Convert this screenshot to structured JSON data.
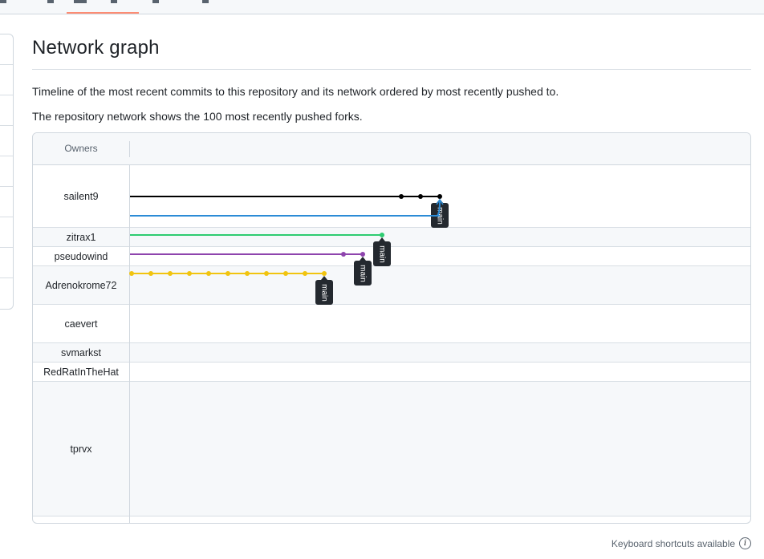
{
  "page": {
    "title": "Network graph",
    "description_1": "Timeline of the most recent commits to this repository and its network ordered by most recently pushed to.",
    "description_2": "The repository network shows the 100 most recently pushed forks.",
    "shortcuts_label": "Keyboard shortcuts available",
    "info_icon": "info-icon"
  },
  "network": {
    "header_label": "Owners",
    "colors": {
      "border": "#d0d7de",
      "shaded_row": "#f6f8fa",
      "label_bg": "#24292f",
      "label_text": "#ffffff"
    },
    "owners": [
      {
        "name": "sailent9",
        "shaded": false
      },
      {
        "name": "zitrax1",
        "shaded": true
      },
      {
        "name": "pseudowind",
        "shaded": false
      },
      {
        "name": "Adrenokrome72",
        "shaded": true
      },
      {
        "name": "caevert",
        "shaded": false
      },
      {
        "name": "svmarkst",
        "shaded": true
      },
      {
        "name": "RedRatInTheHat",
        "shaded": false
      },
      {
        "name": "tprvx",
        "shaded": true
      }
    ],
    "branches": [
      {
        "owner": "sailent9",
        "color": "#000000",
        "commits": 3,
        "label": "main"
      },
      {
        "owner": "sailent9",
        "color": "#2b8bd6",
        "commits": 0,
        "label": ""
      },
      {
        "owner": "zitrax1",
        "color": "#2ecc71",
        "commits": 1,
        "label": "main"
      },
      {
        "owner": "pseudowind",
        "color": "#8e44ad",
        "commits": 2,
        "label": "main"
      },
      {
        "owner": "Adrenokrome72",
        "color": "#f1c40f",
        "commits": 11,
        "label": "main"
      }
    ]
  }
}
